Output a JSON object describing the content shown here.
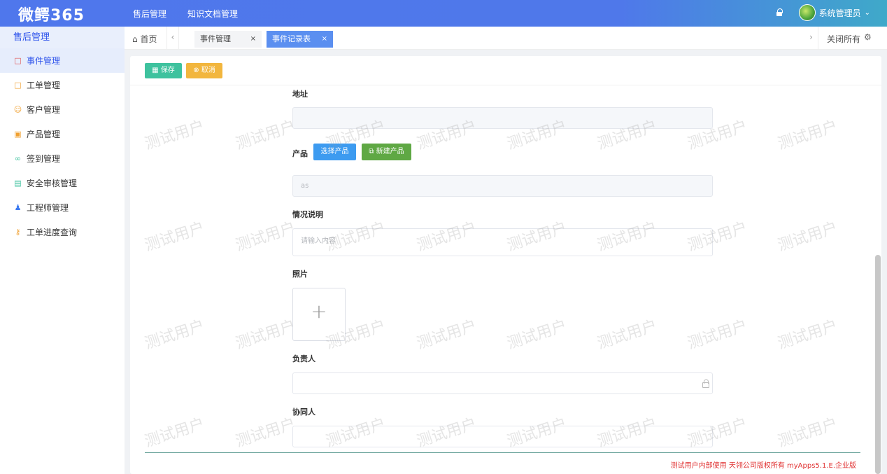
{
  "app": {
    "logo": "微鳄365"
  },
  "topnav": {
    "items": [
      "售后管理",
      "知识文档管理"
    ]
  },
  "user": {
    "name": "系统管理员"
  },
  "sidebar": {
    "title": "售后管理",
    "items": [
      {
        "label": "事件管理",
        "icon": "file-icon",
        "color": "#e05555"
      },
      {
        "label": "工单管理",
        "icon": "file-icon",
        "color": "#f0a030"
      },
      {
        "label": "客户管理",
        "icon": "users-icon",
        "color": "#f0a030"
      },
      {
        "label": "产品管理",
        "icon": "box-icon",
        "color": "#f0a030"
      },
      {
        "label": "签到管理",
        "icon": "checkin-icon",
        "color": "#3ec29e"
      },
      {
        "label": "安全审核管理",
        "icon": "audit-icon",
        "color": "#3ec29e"
      },
      {
        "label": "工程师管理",
        "icon": "person-icon",
        "color": "#3d7bf0"
      },
      {
        "label": "工单进度查询",
        "icon": "key-icon",
        "color": "#f0a030"
      }
    ]
  },
  "tabs": {
    "home": "首页",
    "items": [
      {
        "label": "事件管理",
        "close": "×"
      },
      {
        "label": "事件记录表",
        "close": "×"
      }
    ],
    "close_all": "关闭所有"
  },
  "actions": {
    "save": "保存",
    "cancel": "取消"
  },
  "form": {
    "address": {
      "label": "地址",
      "value": ""
    },
    "product": {
      "label": "产品",
      "pick_button": "选择产品",
      "new_button": "新建产品",
      "value": "as"
    },
    "description": {
      "label": "情况说明",
      "placeholder": "请输入内容"
    },
    "photo": {
      "label": "照片"
    },
    "owner": {
      "label": "负责人",
      "value": ""
    },
    "collaborator": {
      "label": "协同人",
      "value": ""
    }
  },
  "footer": {
    "text": "测试用户内部使用 天翎公司版权所有 myApps5.1.E.企业版"
  },
  "watermark": {
    "text": "测试用户"
  }
}
